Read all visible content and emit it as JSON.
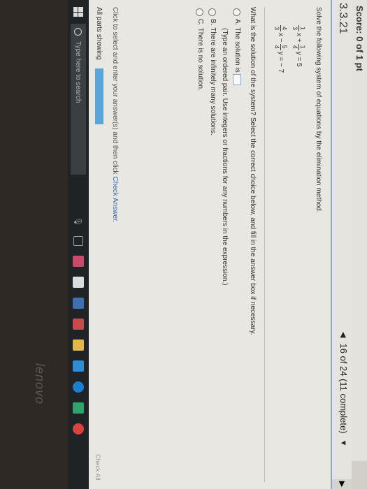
{
  "score": "Score: 0 of 1 pt",
  "question_number": "3.3.21",
  "nav": {
    "prev_icon": "triangle-left-icon",
    "progress": "16 of 24 (11 complete)",
    "dropdown_icon": "triangle-down-icon",
    "next_icon": "triangle-right-icon"
  },
  "instruction": "Solve the following system of equations by the elimination method.",
  "equations": [
    {
      "a_num": "1",
      "a_den": "3",
      "var1": "x +",
      "b_num": "1",
      "b_den": "4",
      "var2": "y = 5"
    },
    {
      "a_num": "4",
      "a_den": "3",
      "var1": "x −",
      "b_num": "5",
      "b_den": "4",
      "var2": "y = − 7"
    }
  ],
  "prompt": "What is the solution of the system? Select the correct choice below, and fill in the answer box if necessary.",
  "choices": [
    {
      "letter": "A.",
      "text": "The solution is",
      "note": "(Type an ordered pair. Use integers or fractions for any numbers in the expression.)"
    },
    {
      "letter": "B.",
      "text": "There are infinitely many solutions."
    },
    {
      "letter": "C.",
      "text": "There is no solution."
    }
  ],
  "footer": {
    "prefix": "Click to select and enter your answer(s) and then click ",
    "link": "Check Answer.",
    "parts": "All parts showing",
    "check_all": "Check All"
  },
  "taskbar": {
    "search_placeholder": "Type here to search"
  },
  "brand": "lenovo",
  "colors": {
    "accent": "#5aa6d8",
    "link": "#3a66a3",
    "taskbar": "#1f2326"
  }
}
